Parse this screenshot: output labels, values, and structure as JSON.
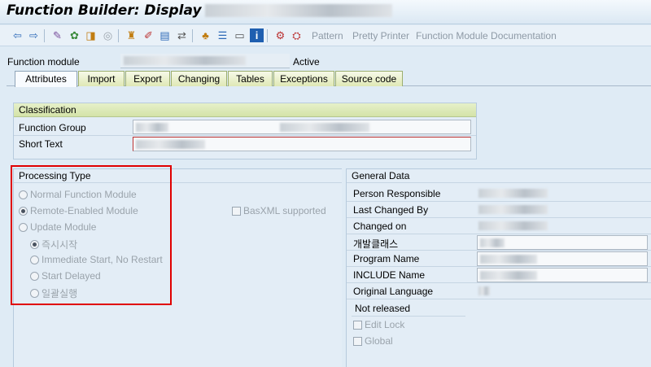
{
  "window": {
    "title": "Function Builder: Display"
  },
  "toolbar": {
    "icons": [
      "back-icon",
      "forward-icon",
      "other-object-icon",
      "display-change-icon",
      "active-inactive-icon",
      "check-icon",
      "activate-icon",
      "test-icon",
      "where-used-icon",
      "display-object-list-icon",
      "hierarchy-icon",
      "navigation-window-icon",
      "info-icon",
      "help-icon",
      "sap-icon"
    ],
    "buttons": {
      "pattern": "Pattern",
      "pretty_printer": "Pretty Printer",
      "documentation": "Function Module Documentation"
    }
  },
  "header": {
    "label": "Function module",
    "status": "Active"
  },
  "tabs": [
    "Attributes",
    "Import",
    "Export",
    "Changing",
    "Tables",
    "Exceptions",
    "Source code"
  ],
  "classification": {
    "title": "Classification",
    "function_group_label": "Function Group",
    "short_text_label": "Short Text"
  },
  "processing": {
    "title": "Processing Type",
    "normal": "Normal Function Module",
    "remote": "Remote-Enabled Module",
    "basxml": "BasXML supported",
    "update": "Update Module",
    "immediate": "즉시시작",
    "immediate_no_restart": "Immediate Start, No Restart",
    "delayed": "Start Delayed",
    "collective": "일괄실행"
  },
  "general": {
    "title": "General Data",
    "person": "Person Responsible",
    "last_changed": "Last Changed By",
    "changed_on": "Changed on",
    "dev_class": "개발클래스",
    "program": "Program Name",
    "include": "INCLUDE Name",
    "language": "Original Language",
    "released": "Not released",
    "edit_lock": "Edit Lock",
    "global": "Global"
  },
  "colors": {
    "highlight": "#e00000",
    "tab_active": "#f8fbff",
    "group_header": "#d4e3a8"
  }
}
